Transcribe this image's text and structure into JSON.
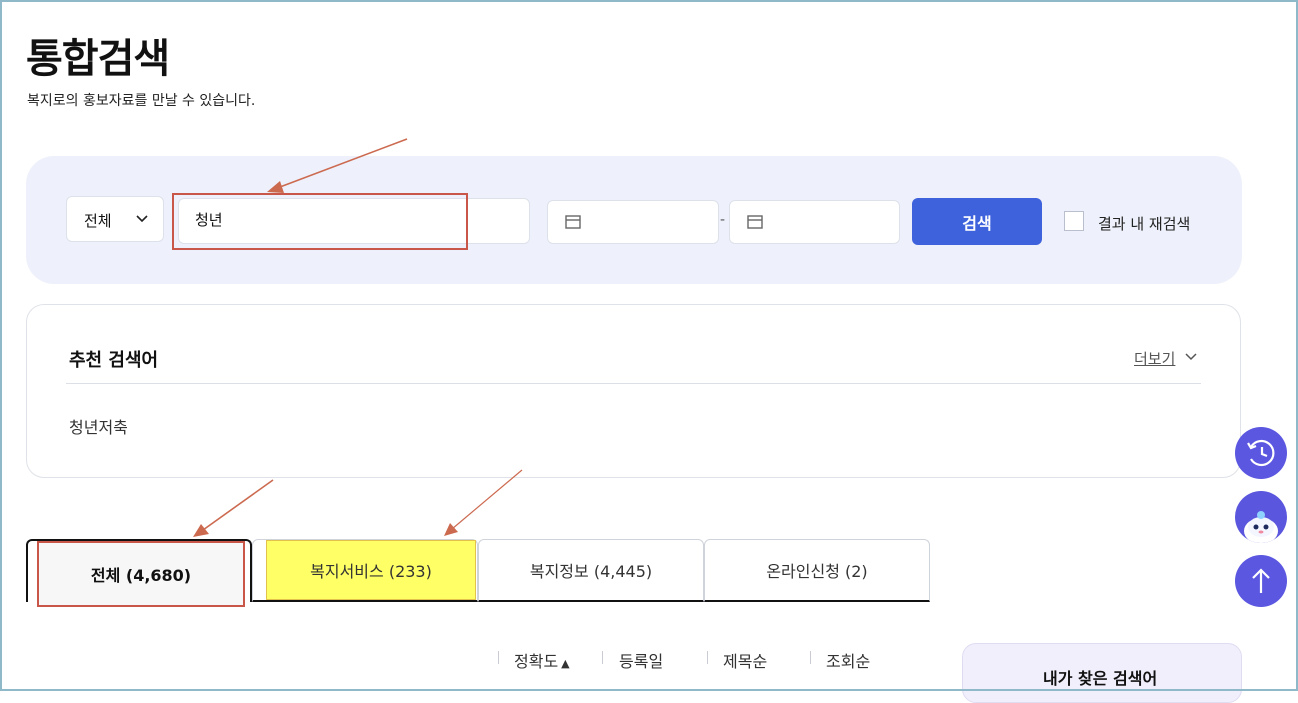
{
  "header": {
    "title": "통합검색",
    "subtitle": "복지로의 홍보자료를 만날 수 있습니다."
  },
  "search": {
    "category": "전체",
    "keyword": "청년",
    "date_separator": "-",
    "search_button": "검색",
    "research_label": "결과 내 재검색",
    "research_checked": false
  },
  "recommend": {
    "title": "추천 검색어",
    "more_label": "더보기",
    "keywords": [
      "청년저축"
    ]
  },
  "tabs": [
    {
      "label": "전체 (4,680)",
      "active": true
    },
    {
      "label": "복지서비스 (233)"
    },
    {
      "label": "복지정보 (4,445)"
    },
    {
      "label": "온라인신청 (2)"
    }
  ],
  "sort": {
    "options": [
      "정확도",
      "등록일",
      "제목순",
      "조회순"
    ],
    "active_indicator": "▲"
  },
  "history": {
    "title": "내가 찾은 검색어"
  },
  "colors": {
    "primary": "#3e62dc",
    "float_button": "#5b57e0",
    "panel_bg": "#eef1fb",
    "annotation": "#c8574a",
    "highlight": "#ffff66"
  },
  "floating_buttons": [
    "history-icon",
    "chatbot-icon",
    "arrow-up-icon"
  ]
}
